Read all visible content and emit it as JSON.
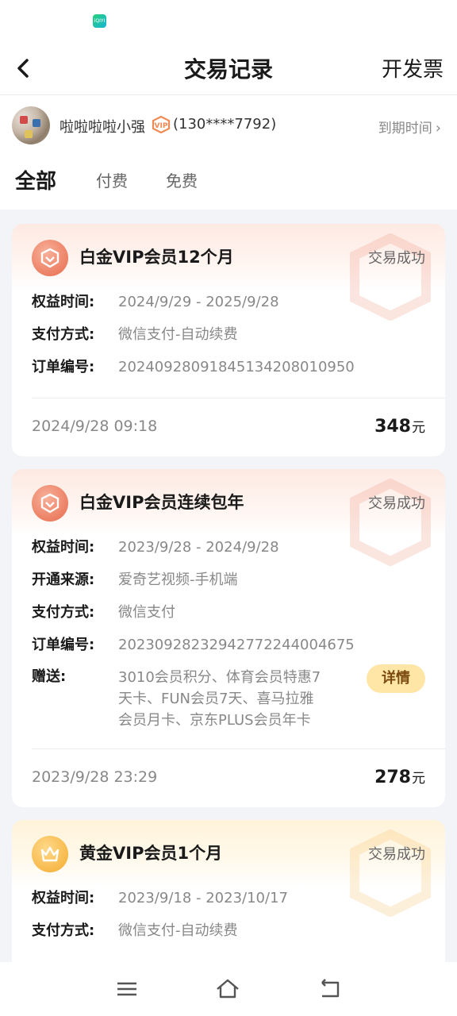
{
  "status_bar": {
    "app_icon_label": "iQIYI"
  },
  "nav": {
    "title": "交易记录",
    "invoice_label": "开发票"
  },
  "user": {
    "name": "啦啦啦啦小强",
    "phone": "(130****7792)",
    "expire_label": "到期时间"
  },
  "tabs": [
    {
      "label": "全部",
      "active": true
    },
    {
      "label": "付费",
      "active": false
    },
    {
      "label": "免费",
      "active": false
    }
  ],
  "records": [
    {
      "tier": "platinum",
      "title": "白金VIP会员12个月",
      "status": "交易成功",
      "rows": [
        {
          "key": "权益时间:",
          "value": "2024/9/29 - 2025/9/28"
        },
        {
          "key": "支付方式:",
          "value": "微信支付-自动续费"
        },
        {
          "key": "订单编号:",
          "value": "202409280918451342080109 50"
        }
      ],
      "time": "2024/9/28 09:18",
      "price": "348",
      "unit": "元"
    },
    {
      "tier": "platinum",
      "title": "白金VIP会员连续包年",
      "status": "交易成功",
      "rows": [
        {
          "key": "权益时间:",
          "value": "2023/9/28 - 2024/9/28"
        },
        {
          "key": "开通来源:",
          "value": "爱奇艺视频-手机端"
        },
        {
          "key": "支付方式:",
          "value": "微信支付"
        },
        {
          "key": "订单编号:",
          "value": "20230928232942772244004675"
        }
      ],
      "gift_key": "赠送:",
      "gift_lines": [
        "3010会员积分、体育会员特惠7",
        "天卡、FUN会员7天、喜马拉雅",
        "会员月卡、京东PLUS会员年卡"
      ],
      "detail_label": "详情",
      "time": "2023/9/28 23:29",
      "price": "278",
      "unit": "元"
    },
    {
      "tier": "gold",
      "title": "黄金VIP会员1个月",
      "status": "交易成功",
      "rows": [
        {
          "key": "权益时间:",
          "value": "2023/9/18 - 2023/10/17"
        },
        {
          "key": "支付方式:",
          "value": "微信支付-自动续费"
        }
      ]
    }
  ],
  "bottom_nav": {
    "keys": [
      "menu-icon",
      "home-icon",
      "back-icon"
    ]
  },
  "colors": {
    "accent_platinum": "#ec7f63",
    "accent_gold": "#f7b94a",
    "detail_bg": "#ffe6a6"
  }
}
